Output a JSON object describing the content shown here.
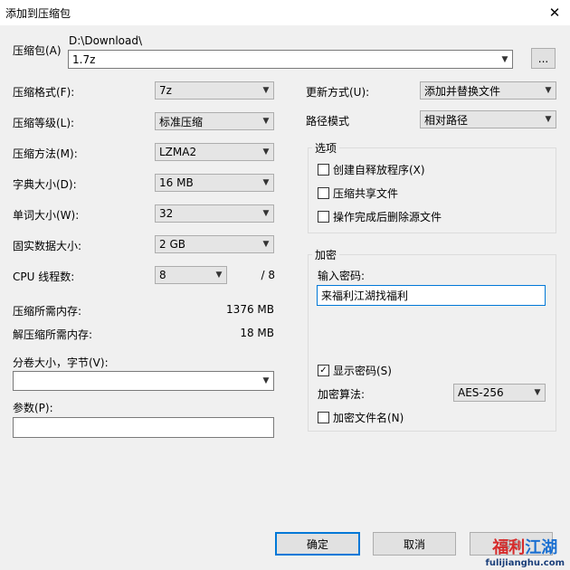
{
  "window": {
    "title": "添加到压缩包",
    "close_glyph": "✕"
  },
  "archive": {
    "label": "压缩包(A)",
    "path": "D:\\Download\\",
    "filename": "1.7z",
    "browse_label": "..."
  },
  "left": {
    "format": {
      "label": "压缩格式(F):",
      "value": "7z"
    },
    "level": {
      "label": "压缩等级(L):",
      "value": "标准压缩"
    },
    "method": {
      "label": "压缩方法(M):",
      "value": "LZMA2"
    },
    "dict": {
      "label": "字典大小(D):",
      "value": "16 MB"
    },
    "word": {
      "label": "单词大小(W):",
      "value": "32"
    },
    "solid": {
      "label": "固实数据大小:",
      "value": "2 GB"
    },
    "threads": {
      "label": "CPU 线程数:",
      "value": "8",
      "max": "/ 8"
    },
    "mem_compress": {
      "label": "压缩所需内存:",
      "value": "1376 MB"
    },
    "mem_decompress": {
      "label": "解压缩所需内存:",
      "value": "18 MB"
    },
    "volume": {
      "label": "分卷大小，字节(V):",
      "value": ""
    },
    "params": {
      "label": "参数(P):",
      "value": ""
    }
  },
  "right": {
    "update": {
      "label": "更新方式(U):",
      "value": "添加并替换文件"
    },
    "path_mode": {
      "label": "路径模式",
      "value": "相对路径"
    },
    "options": {
      "title": "选项",
      "sfx": {
        "label": "创建自释放程序(X)",
        "checked": false
      },
      "shared": {
        "label": "压缩共享文件",
        "checked": false
      },
      "delete_after": {
        "label": "操作完成后删除源文件",
        "checked": false
      }
    },
    "encryption": {
      "title": "加密",
      "password_label": "输入密码:",
      "password_value": "来福利江湖找福利",
      "show_password": {
        "label": "显示密码(S)",
        "checked": true
      },
      "method_label": "加密算法:",
      "method_value": "AES-256",
      "encrypt_names": {
        "label": "加密文件名(N)",
        "checked": false
      }
    }
  },
  "buttons": {
    "ok": "确定",
    "cancel": "取消",
    "help": "帮助"
  },
  "watermark": {
    "text_red": "福利",
    "text_blue": "江湖",
    "url": "fulijianghu.com"
  },
  "icons": {
    "chevron": "chevron-down-icon",
    "check": "check-icon",
    "close": "close-icon"
  }
}
